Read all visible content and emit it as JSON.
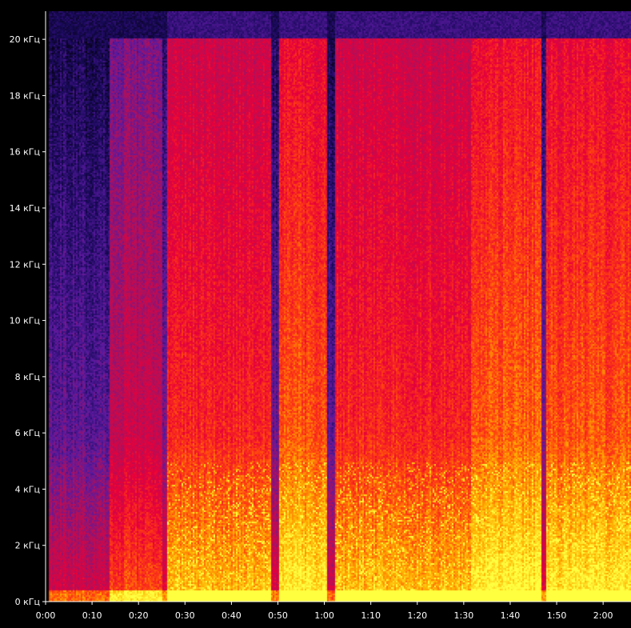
{
  "chart_data": {
    "type": "heatmap",
    "title": "",
    "xlabel": "",
    "ylabel": "",
    "x_unit": "time (m:ss)",
    "y_unit": "kHz",
    "xlim": [
      0,
      126
    ],
    "ylim": [
      0,
      21
    ],
    "x_ticks": [
      {
        "value": 0,
        "label": "0:00"
      },
      {
        "value": 10,
        "label": "0:10"
      },
      {
        "value": 20,
        "label": "0:20"
      },
      {
        "value": 30,
        "label": "0:30"
      },
      {
        "value": 40,
        "label": "0:40"
      },
      {
        "value": 50,
        "label": "0:50"
      },
      {
        "value": 60,
        "label": "1:00"
      },
      {
        "value": 70,
        "label": "1:10"
      },
      {
        "value": 80,
        "label": "1:20"
      },
      {
        "value": 90,
        "label": "1:30"
      },
      {
        "value": 100,
        "label": "1:40"
      },
      {
        "value": 110,
        "label": "1:50"
      },
      {
        "value": 120,
        "label": "2:00"
      }
    ],
    "y_ticks": [
      {
        "value": 0,
        "label": "0 кГц"
      },
      {
        "value": 2,
        "label": "2 кГц"
      },
      {
        "value": 4,
        "label": "4 кГц"
      },
      {
        "value": 6,
        "label": "6 кГц"
      },
      {
        "value": 8,
        "label": "8 кГц"
      },
      {
        "value": 10,
        "label": "10 кГц"
      },
      {
        "value": 12,
        "label": "12 кГц"
      },
      {
        "value": 14,
        "label": "14 кГц"
      },
      {
        "value": 16,
        "label": "16 кГц"
      },
      {
        "value": 18,
        "label": "18 кГц"
      },
      {
        "value": 20,
        "label": "20 кГц"
      }
    ],
    "colormap": [
      "#000000",
      "#1a0a5c",
      "#5a1aa0",
      "#b0105a",
      "#e8003a",
      "#ff4010",
      "#ffb000",
      "#ffff40"
    ],
    "audio_cutoff_khz": 20,
    "segments": [
      {
        "t_start": 0.5,
        "t_end": 13.5,
        "intensity": 0.35
      },
      {
        "t_start": 13.5,
        "t_end": 25.0,
        "intensity": 0.55
      },
      {
        "t_start": 25.0,
        "t_end": 26.0,
        "intensity": 0.4
      },
      {
        "t_start": 26.0,
        "t_end": 48.5,
        "intensity": 0.72
      },
      {
        "t_start": 48.5,
        "t_end": 50.0,
        "intensity": 0.38
      },
      {
        "t_start": 50.0,
        "t_end": 60.5,
        "intensity": 0.8
      },
      {
        "t_start": 60.5,
        "t_end": 62.0,
        "intensity": 0.36
      },
      {
        "t_start": 62.0,
        "t_end": 91.5,
        "intensity": 0.72
      },
      {
        "t_start": 91.5,
        "t_end": 106.5,
        "intensity": 0.82
      },
      {
        "t_start": 106.5,
        "t_end": 107.5,
        "intensity": 0.42
      },
      {
        "t_start": 107.5,
        "t_end": 126.0,
        "intensity": 0.8
      }
    ]
  }
}
